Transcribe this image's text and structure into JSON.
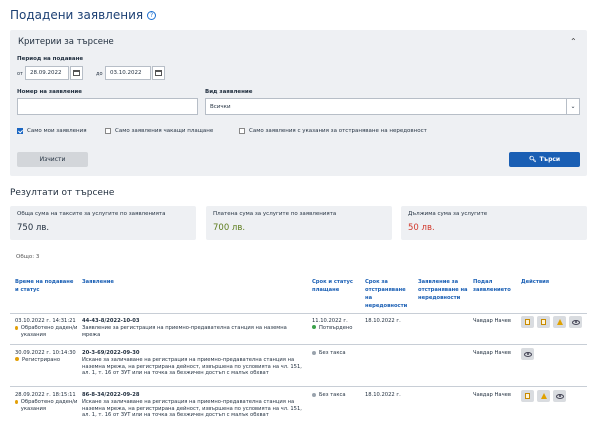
{
  "page": {
    "title": "Подадени заявления",
    "help_icon": "?"
  },
  "filters": {
    "title": "Критерии за търсене",
    "period_label": "Период на подаване",
    "from_label": "от",
    "from_value": "28.09.2022",
    "to_label": "до",
    "to_value": "03.10.2022",
    "number_label": "Номер на заявление",
    "number_value": "",
    "type_label": "Вид заявление",
    "type_value": "Всички",
    "check_mine": "Само мои заявления",
    "check_awaiting_payment": "Само заявления чакащи плащане",
    "check_with_instructions": "Само заявления с указания за отстраняване на нередовност",
    "clear_button": "Изчисти",
    "search_button": "Търси"
  },
  "results": {
    "title": "Резултати от търсене",
    "summary": [
      {
        "label": "Обща сума на таксите за услугите по заявленията",
        "value": "750 лв.",
        "color": "#1f2d3d"
      },
      {
        "label": "Платена сума за услугите по заявленията",
        "value": "700 лв.",
        "color": "#5e7d1e"
      },
      {
        "label": "Дължима сума за услугите",
        "value": "50 лв.",
        "color": "#d1392c"
      }
    ],
    "total": "Общо: 3",
    "columns": {
      "time": "Време на подаване и статус",
      "application": "Заявление",
      "payment": "Срок и статус плащане",
      "deadline": "Срок за отстраняване на нередовности",
      "fixed": "Заявление за отстраняване на нередовности",
      "applicant": "Подал заявлението",
      "actions": "Действия"
    },
    "rows": [
      {
        "time": "03.10.2022 г. 14:31:21",
        "status": "Обработено даден/и указания",
        "status_color": "#e3a008",
        "number": "44-43-8/2022-10-03",
        "desc": "Заявление за регистрация на приемно-предавателна станция на наземна мрежа",
        "payment_date": "11.10.2022 г.",
        "payment_status": "Потвърдено",
        "payment_color": "#3aa14a",
        "deadline": "18.10.2022 г.",
        "applicant": "Чавдар Начев"
      },
      {
        "time": "30.09.2022 г. 10:14:30",
        "status": "Регистрирано",
        "status_color": "#e3a008",
        "number": "20-3-69/2022-09-30",
        "desc": "Искане за заличаване на регистрация на приемно-предавателна станция на наземна мрежа, на регистрирана дейност, извършена по условията на чл. 151, ал. 1, т. 16 от ЗУТ или на точка за безжичен достъп с малък обхват",
        "payment_date": "",
        "payment_status": "Без такса",
        "payment_color": "#9aa3ad",
        "deadline": "",
        "applicant": "Чавдар Начев"
      },
      {
        "time": "28.09.2022 г. 18:15:11",
        "status": "Обработено даден/и указания",
        "status_color": "#e3a008",
        "number": "86-8-34/2022-09-28",
        "desc": "Искане за заличаване на регистрация на приемно-предавателна станция на наземна мрежа, на регистрирана дейност, извършена по условията на чл. 151, ал. 1, т. 16 от ЗУТ или на точка за безжичен достъп с малък обхват",
        "payment_date": "",
        "payment_status": "Без такса",
        "payment_color": "#9aa3ad",
        "deadline": "18.10.2022 г.",
        "applicant": "Чавдар Начев"
      }
    ]
  }
}
